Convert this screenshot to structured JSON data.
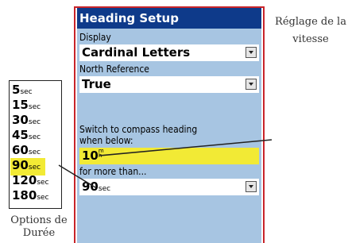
{
  "window": {
    "title": "Heading Setup"
  },
  "display": {
    "label": "Display",
    "value": "Cardinal Letters"
  },
  "north_reference": {
    "label": "North Reference",
    "value": "True"
  },
  "switch": {
    "label_line1": "Switch to compass heading",
    "label_line2": "when below:",
    "speed_value": "10",
    "speed_unit_top": "m",
    "speed_unit_bottom": "h"
  },
  "duration": {
    "label": "for more than...",
    "value": "90",
    "unit": "sec"
  },
  "duration_options": [
    {
      "value": "5",
      "unit": "sec"
    },
    {
      "value": "15",
      "unit": "sec"
    },
    {
      "value": "30",
      "unit": "sec"
    },
    {
      "value": "45",
      "unit": "sec"
    },
    {
      "value": "60",
      "unit": "sec"
    },
    {
      "value": "90",
      "unit": "sec",
      "selected": true
    },
    {
      "value": "120",
      "unit": "sec"
    },
    {
      "value": "180",
      "unit": "sec"
    }
  ],
  "captions": {
    "speed_line1": "Réglage de la",
    "speed_line2": "vitesse",
    "duration_line1": "Options de",
    "duration_line2": "Durée"
  },
  "colors": {
    "title_bar": "#0e3a8a",
    "panel": "#a7c5e2",
    "highlight": "#f2ea35",
    "frame": "#c8242a"
  }
}
